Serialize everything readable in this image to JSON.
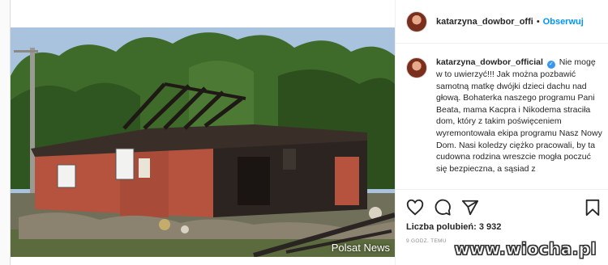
{
  "post": {
    "username": "katarzyna_dowbor_offi",
    "separator": "•",
    "follow_label": "Obserwuj"
  },
  "caption": {
    "username": "katarzyna_dowbor_official",
    "verified_glyph": "✓",
    "text": "Nie mogę w to uwierzyć!!! Jak można pozbawić samotną matkę dwójki dzieci dachu nad głową. Bohaterka naszego programu Pani Beata, mama Kacpra i Nikodema straciła dom, który z takim poświęceniem wyremontowała ekipa programu Nasz Nowy Dom. Nasi koledzy ciężko pracowali, by ta cudowna rodzina wreszcie mogła poczuć się bezpieczna, a sąsiad z"
  },
  "photo": {
    "watermark": "Polsat News"
  },
  "actions": {
    "icons": [
      "heart-icon",
      "comment-icon",
      "share-icon",
      "bookmark-icon"
    ],
    "likes": "Liczba polubień: 3 932",
    "time": "9 GODZ. TEMU"
  },
  "site": {
    "watermark": "www.wiocha.pl"
  },
  "colors": {
    "link_blue": "#0095f6",
    "verified_blue": "#3897f0",
    "brick": "#b5533f"
  }
}
